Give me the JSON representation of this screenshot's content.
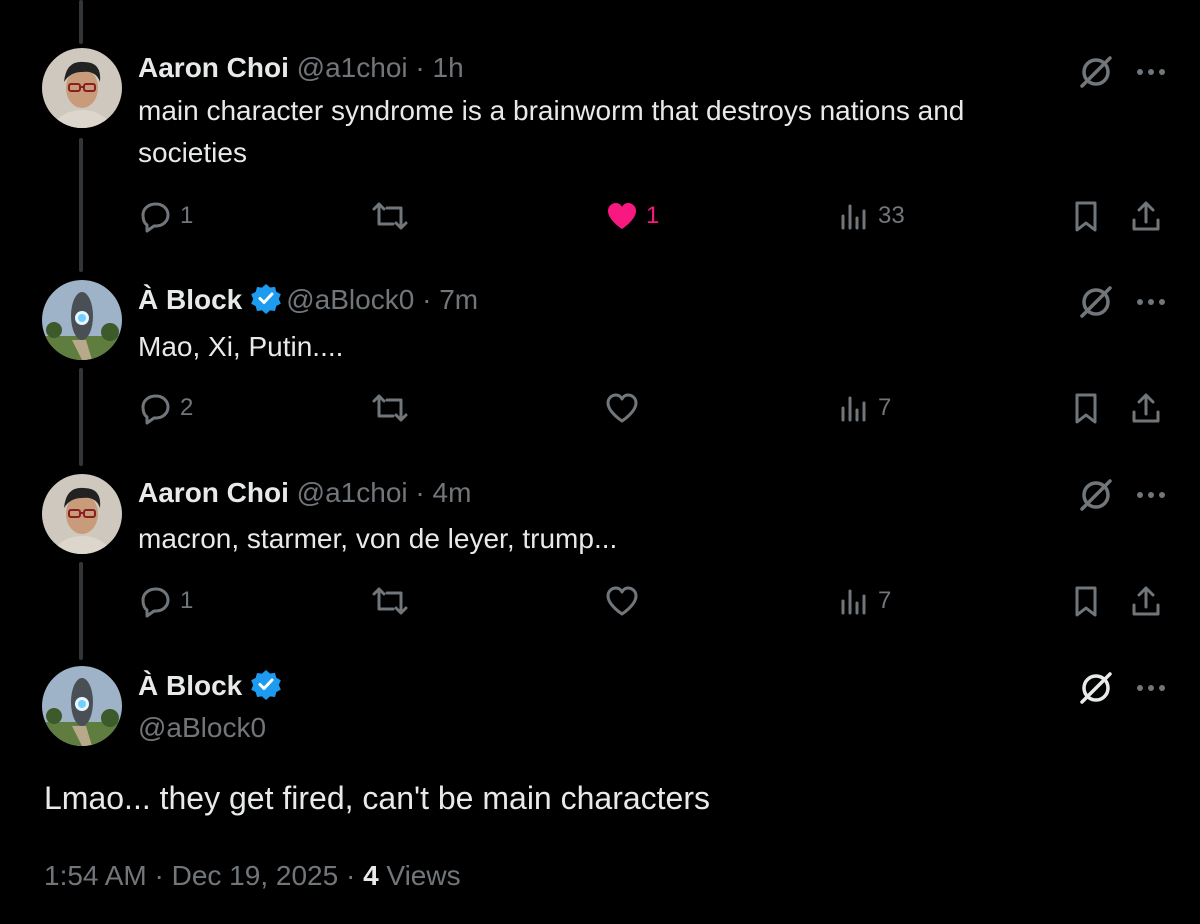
{
  "tweets": [
    {
      "name": "Aaron Choi",
      "handle": "@a1choi",
      "sep": "·",
      "time": "1h",
      "text": "main character syndrome is a brainworm that destroys nations and societies",
      "replies": "1",
      "likes": "1",
      "views": "33"
    },
    {
      "name": "À Block",
      "handle": "@aBlock0",
      "sep": "·",
      "time": "7m",
      "text": "Mao, Xi, Putin....",
      "replies": "2",
      "views": "7"
    },
    {
      "name": "Aaron Choi",
      "handle": "@a1choi",
      "sep": "·",
      "time": "4m",
      "text": "macron, starmer, von de leyer, trump...",
      "replies": "1",
      "views": "7"
    }
  ],
  "main_tweet": {
    "name": "À Block",
    "handle": "@aBlock0",
    "text": "Lmao... they get fired, can't be main characters",
    "timestamp": "1:54 AM · Dec 19, 2025 · ",
    "views_count": "4",
    "views_label": " Views"
  },
  "colors": {
    "background": "#000000",
    "text": "#e7e9ea",
    "muted": "#71767b",
    "like": "#f91880",
    "verified": "#1d9bf0",
    "thread_line": "#333639"
  },
  "icons": [
    "reply-icon",
    "retweet-icon",
    "like-icon",
    "views-icon",
    "bookmark-icon",
    "share-icon",
    "grok-icon",
    "more-icon",
    "verified-badge-icon"
  ]
}
